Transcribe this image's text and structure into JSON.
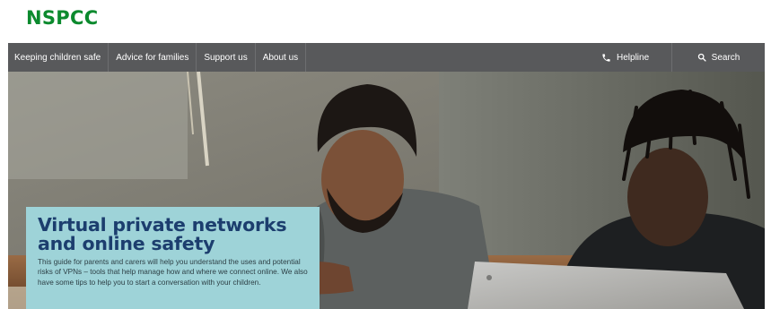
{
  "brand": {
    "logo": "NSPCC",
    "green": "#0c8a2e",
    "navy": "#1c3e6e"
  },
  "nav": {
    "items": [
      {
        "label": "Keeping children safe"
      },
      {
        "label": "Advice for families"
      },
      {
        "label": "Support us"
      },
      {
        "label": "About us"
      }
    ],
    "helpline": {
      "label": "Helpline",
      "icon": "phone-icon"
    },
    "search": {
      "label": "Search",
      "icon": "search-icon"
    }
  },
  "hero": {
    "title": "Virtual private networks and online safety",
    "description": "This guide for parents and carers will help you understand the uses and potential risks of VPNs – tools that help manage how and where we connect online. We also have some tips to help you to start a conversation with your children.",
    "box_color": "#9ed3d8"
  }
}
